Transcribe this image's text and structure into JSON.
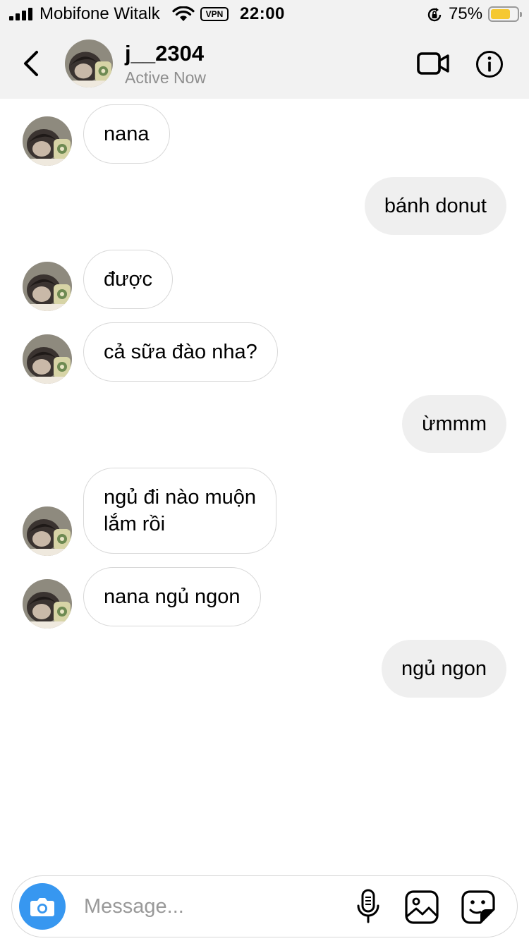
{
  "status_bar": {
    "carrier": "Mobifone Witalk",
    "vpn_label": "VPN",
    "time": "22:00",
    "battery_percent": "75%",
    "battery_level": 0.75
  },
  "header": {
    "username": "j__2304",
    "status": "Active Now"
  },
  "messages": [
    {
      "sender": "them",
      "text_lines": [
        "nana"
      ],
      "avatar": true
    },
    {
      "sender": "me",
      "text_lines": [
        "bánh donut"
      ]
    },
    {
      "sender": "them",
      "text_lines": [
        "được"
      ],
      "avatar": true
    },
    {
      "sender": "them",
      "text_lines": [
        "cả sữa đào nha?"
      ],
      "avatar": true
    },
    {
      "sender": "me",
      "text_lines": [
        "ừmmm"
      ]
    },
    {
      "sender": "them",
      "text_lines": [
        "ngủ đi nào muộn",
        "lắm rồi"
      ],
      "avatar": true
    },
    {
      "sender": "them",
      "text_lines": [
        "nana ngủ ngon"
      ],
      "avatar": true
    },
    {
      "sender": "me",
      "text_lines": [
        "ngủ ngon"
      ]
    }
  ],
  "composer": {
    "placeholder": "Message...",
    "value": ""
  },
  "colors": {
    "bar_background": "#f2f2f2",
    "accent": "#3797f0",
    "outgoing_bubble": "#efefef",
    "incoming_border": "#d8d8d8",
    "secondary_text": "#8e8e8e",
    "battery": "#f5c832"
  },
  "icons": [
    "signal-icon",
    "wifi-icon",
    "rotation-lock-icon",
    "battery-icon",
    "back-chevron-icon",
    "video-call-icon",
    "info-icon",
    "camera-icon",
    "microphone-icon",
    "gallery-icon",
    "sticker-icon"
  ]
}
